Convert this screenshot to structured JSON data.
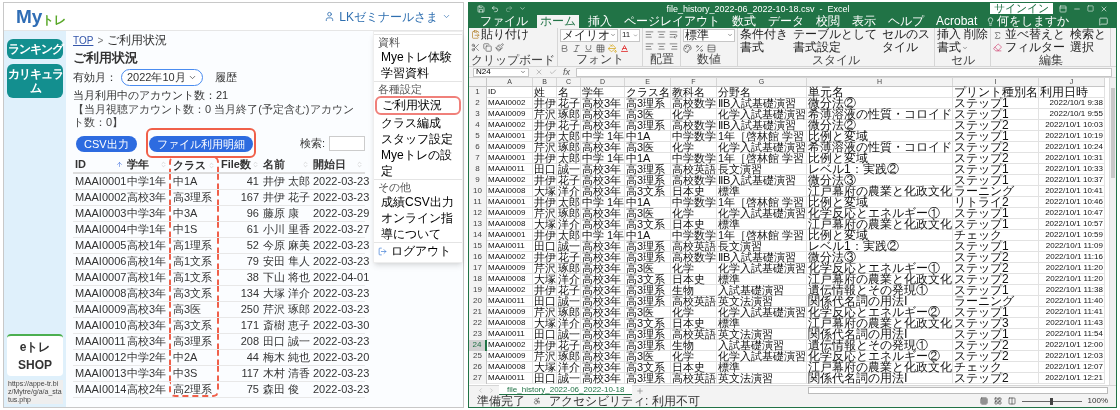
{
  "web_page": {
    "logo": {
      "main": "My",
      "sub": "トレ"
    },
    "user_menu": "LKゼミナールさま",
    "sidebar": {
      "buttons": [
        "ランキング",
        "カリキュラム"
      ],
      "shop_logo": "eトレSHOP"
    },
    "status_url": "https://appe-tr.biz/Mytre/g/a/a_status.php",
    "breadcrumb": {
      "link": "TOP",
      "separator": ">",
      "current": "ご利用状況"
    },
    "title": "ご利用状況",
    "month_filter": {
      "label": "有効月：",
      "value": "2022年10月",
      "history_link": "履歴"
    },
    "account_count": "当月利用中のアカウント数：21",
    "account_note": "【当月視聴アカウント数：0 当月終了(予定含む)アカウント数：0】",
    "buttons": [
      {
        "label": "CSV出力",
        "highlighted": false
      },
      {
        "label": "ファイル利用明細",
        "highlighted": true
      }
    ],
    "search_label": "検索:",
    "table": {
      "columns": [
        {
          "label": "ID",
          "sorted": true,
          "highlighted": false
        },
        {
          "label": "学年",
          "sorted": false,
          "highlighted": false
        },
        {
          "label": "クラス",
          "sorted": false,
          "highlighted": true
        },
        {
          "label": "File数",
          "sorted": false,
          "highlighted": false
        },
        {
          "label": "名前",
          "sorted": false,
          "highlighted": false
        },
        {
          "label": "開始日",
          "sorted": false,
          "highlighted": false
        }
      ],
      "rows": [
        [
          "MAAI0001",
          "中学1年",
          "中1A",
          "41",
          "井伊 太郎",
          "2022-03-23"
        ],
        [
          "MAAI0002",
          "高校3年",
          "高3理系",
          "167",
          "井伊 花子",
          "2022-03-23"
        ],
        [
          "MAAI0003",
          "中学3年",
          "中3A",
          "96",
          "藤原 康",
          "2022-03-29"
        ],
        [
          "MAAI0004",
          "中学1年",
          "中1S",
          "61",
          "小川 里香",
          "2022-03-27"
        ],
        [
          "MAAI0005",
          "高校1年",
          "高1理系",
          "52",
          "今原 麻美",
          "2022-03-23"
        ],
        [
          "MAAI0006",
          "高校1年",
          "高1文系",
          "79",
          "安田 隼人",
          "2022-03-23"
        ],
        [
          "MAAI0007",
          "高校1年",
          "高1文系",
          "38",
          "下山 将也",
          "2022-04-01"
        ],
        [
          "MAAI0008",
          "高校3年",
          "高3文系",
          "134",
          "大塚 洋介",
          "2022-03-23"
        ],
        [
          "MAAI0009",
          "高校3年",
          "高3医",
          "250",
          "芹沢 琢郎",
          "2022-03-23"
        ],
        [
          "MAAI0010",
          "高校3年",
          "高3文系",
          "171",
          "斎樹 恵子",
          "2022-03-30"
        ],
        [
          "MAAI0011",
          "高校3年",
          "高3理系",
          "208",
          "田口 誠一",
          "2022-03-23"
        ],
        [
          "MAAI0012",
          "中学2年",
          "中2A",
          "44",
          "梅木 純也",
          "2022-03-20"
        ],
        [
          "MAAI0013",
          "中学3年",
          "中3S",
          "117",
          "木村 清香",
          "2022-03-23"
        ],
        [
          "MAAI0014",
          "高校2年",
          "高2理系",
          "75",
          "森田 俊",
          "2022-03-23"
        ]
      ]
    },
    "dropdown_menu": [
      {
        "kind": "heading",
        "label": "資料"
      },
      {
        "kind": "item",
        "label": "Myeトレ体験",
        "highlighted": false
      },
      {
        "kind": "item",
        "label": "学習資料",
        "highlighted": false
      },
      {
        "kind": "heading",
        "label": "各種設定"
      },
      {
        "kind": "item",
        "label": "ご利用状況",
        "highlighted": true
      },
      {
        "kind": "item",
        "label": "クラス編成",
        "highlighted": false
      },
      {
        "kind": "item",
        "label": "スタッフ設定",
        "highlighted": false
      },
      {
        "kind": "item",
        "label": "Myeトレの設定",
        "highlighted": false
      },
      {
        "kind": "heading",
        "label": "その他"
      },
      {
        "kind": "item",
        "label": "成績CSV出力",
        "highlighted": false
      },
      {
        "kind": "item",
        "label": "オンライン指導について",
        "highlighted": false
      },
      {
        "kind": "logout",
        "label": "ログアウト"
      }
    ]
  },
  "excel": {
    "title": "file_history_2022-06_2022-10-18.csv  -  Excel",
    "sign_in": "サインイン",
    "tabs": [
      {
        "label": "ファイル",
        "selected": false
      },
      {
        "label": "ホーム",
        "selected": true
      },
      {
        "label": "挿入",
        "selected": false
      },
      {
        "label": "ページレイアウト",
        "selected": false
      },
      {
        "label": "数式",
        "selected": false
      },
      {
        "label": "データ",
        "selected": false
      },
      {
        "label": "校閲",
        "selected": false
      },
      {
        "label": "表示",
        "selected": false
      },
      {
        "label": "ヘルプ",
        "selected": false
      },
      {
        "label": "Acrobat",
        "selected": false
      }
    ],
    "tell_me": "何をしますか",
    "ribbon": {
      "font_name": "メイリオ",
      "font_size": "11",
      "number_format": "標準",
      "groups": [
        {
          "kind": "clipboard",
          "label": "クリップボード",
          "buttons": [
            "貼り付け"
          ]
        },
        {
          "kind": "font",
          "label": "フォント"
        },
        {
          "kind": "alignment",
          "label": "配置"
        },
        {
          "kind": "number",
          "label": "数値"
        },
        {
          "kind": "styles",
          "label": "スタイル",
          "buttons": [
            "条件付き書式",
            "テーブルとして書式設定",
            "セルのスタイル"
          ]
        },
        {
          "kind": "cells",
          "label": "セル",
          "buttons": [
            "挿入",
            "削除",
            "書式"
          ]
        },
        {
          "kind": "editing",
          "label": "編集",
          "buttons": [
            "並べ替えとフィルター",
            "検索と選択"
          ]
        }
      ]
    },
    "name_box": "N24",
    "function_label": "fx",
    "column_letters": [
      "A",
      "B",
      "C",
      "D",
      "E",
      "F",
      "G",
      "H",
      "I",
      "J"
    ],
    "rows": [
      {
        "number": "1",
        "selected": false,
        "cells": [
          "ID",
          "姓",
          "名",
          "学年",
          "クラス名",
          "教科名",
          "分野名",
          "単元名",
          "プリント種別名",
          "利用日時"
        ]
      },
      {
        "number": "2",
        "selected": false,
        "cells": [
          "MAAI0002",
          "井伊",
          "花子",
          "高校3年",
          "高3理系",
          "高校数学",
          "ⅡB入試基礎演習",
          "微分法②",
          "ステップ1",
          "2022/10/1 9:38"
        ]
      },
      {
        "number": "3",
        "selected": false,
        "cells": [
          "MAAI0009",
          "芹沢",
          "琢郎",
          "高校3年",
          "高3医",
          "化学",
          "化学入試基礎演習",
          "希薄溶液の性質・コロイド",
          "ステップ1",
          "2022/10/1 9:55"
        ]
      },
      {
        "number": "4",
        "selected": false,
        "cells": [
          "MAAI0002",
          "井伊",
          "花子",
          "高校3年",
          "高3理系",
          "高校数学",
          "ⅡB入試基礎演習",
          "微分法②",
          "ステップ2",
          "2022/10/1 10:03"
        ]
      },
      {
        "number": "5",
        "selected": false,
        "cells": [
          "MAAI0001",
          "井伊",
          "太郎",
          "中学 1年",
          "中1A",
          "中学数学",
          "1年［啓林館 学習",
          "比例と変域",
          "ステップ1",
          "2022/10/1 10:19"
        ]
      },
      {
        "number": "6",
        "selected": false,
        "cells": [
          "MAAI0009",
          "芹沢",
          "琢郎",
          "高校3年",
          "高3医",
          "化学",
          "化学入試基礎演習",
          "希薄溶液の性質・コロイド",
          "ステップ2",
          "2022/10/1 10:24"
        ]
      },
      {
        "number": "7",
        "selected": false,
        "cells": [
          "MAAI0001",
          "井伊",
          "太郎",
          "中学 1年",
          "中1A",
          "中学数学",
          "1年［啓林館 学習",
          "比例と変域",
          "ステップ2",
          "2022/10/1 10:31"
        ]
      },
      {
        "number": "8",
        "selected": false,
        "cells": [
          "MAAI0011",
          "田口",
          "誠一",
          "高校3年",
          "高3理系",
          "高校英語",
          "長文演習",
          "レベル1：実践②",
          "ステップ1",
          "2022/10/1 10:33"
        ]
      },
      {
        "number": "9",
        "selected": false,
        "cells": [
          "MAAI0002",
          "井伊",
          "花子",
          "高校3年",
          "高3理系",
          "高校数学",
          "ⅡB入試基礎演習",
          "微分法③",
          "ステップ1",
          "2022/10/1 10:37"
        ]
      },
      {
        "number": "10",
        "selected": false,
        "cells": [
          "MAAI0008",
          "大塚",
          "洋介",
          "高校3年",
          "高3文系",
          "日本史",
          "標準",
          "江戸幕府の農業と化政文化",
          "ラーニング",
          "2022/10/1 10:41"
        ]
      },
      {
        "number": "11",
        "selected": false,
        "cells": [
          "MAAI0001",
          "井伊",
          "太郎",
          "中学 1年",
          "中1A",
          "中学数学",
          "1年［啓林館 学習",
          "比例と変域",
          "リトライ2",
          "2022/10/1 10:46"
        ]
      },
      {
        "number": "12",
        "selected": false,
        "cells": [
          "MAAI0009",
          "芹沢",
          "琢郎",
          "高校3年",
          "高3医",
          "化学",
          "化学入試基礎演習",
          "化学反応とエネルギー①",
          "ステップ1",
          "2022/10/1 10:47"
        ]
      },
      {
        "number": "13",
        "selected": false,
        "cells": [
          "MAAI0008",
          "大塚",
          "洋介",
          "高校3年",
          "高3文系",
          "日本史",
          "標準",
          "江戸幕府の農業と化政文化",
          "ステップ1",
          "2022/10/1 10:57"
        ]
      },
      {
        "number": "14",
        "selected": false,
        "cells": [
          "MAAI0001",
          "井伊",
          "太郎",
          "中学 1年",
          "中1A",
          "中学数学",
          "1年［啓林館 学習",
          "比例と変域",
          "チェック",
          "2022/10/1 10:59"
        ]
      },
      {
        "number": "15",
        "selected": false,
        "cells": [
          "MAAI0011",
          "田口",
          "誠一",
          "高校3年",
          "高3理系",
          "高校英語",
          "長文演習",
          "レベル1：実践②",
          "ステップ1",
          "2022/10/1 11:09"
        ]
      },
      {
        "number": "16",
        "selected": false,
        "cells": [
          "MAAI0002",
          "井伊",
          "花子",
          "高校3年",
          "高3理系",
          "高校数学",
          "ⅡB入試基礎演習",
          "微分法③",
          "ステップ2",
          "2022/10/1 11:16"
        ]
      },
      {
        "number": "17",
        "selected": false,
        "cells": [
          "MAAI0009",
          "芹沢",
          "琢郎",
          "高校3年",
          "高3医",
          "化学",
          "化学入試基礎演習",
          "化学反応とエネルギー①",
          "ステップ2",
          "2022/10/1 11:20"
        ]
      },
      {
        "number": "18",
        "selected": false,
        "cells": [
          "MAAI0008",
          "大塚",
          "洋介",
          "高校3年",
          "高3文系",
          "日本史",
          "標準",
          "江戸幕府の農業と化政文化",
          "ステップ2",
          "2022/10/1 11:20"
        ]
      },
      {
        "number": "19",
        "selected": false,
        "cells": [
          "MAAI0002",
          "井伊",
          "花子",
          "高校3年",
          "高3理系",
          "生物",
          "入試基礎演習",
          "遺伝情報とその発現①",
          "ステップ1",
          "2022/10/1 11:38"
        ]
      },
      {
        "number": "20",
        "selected": false,
        "cells": [
          "MAAI0011",
          "田口",
          "誠一",
          "高校3年",
          "高3理系",
          "高校英語",
          "英文法演習",
          "関係代名詞の用法Ⅰ",
          "ラーニング",
          "2022/10/1 11:40"
        ]
      },
      {
        "number": "21",
        "selected": false,
        "cells": [
          "MAAI0009",
          "芹沢",
          "琢郎",
          "高校3年",
          "高3医",
          "化学",
          "化学入試基礎演習",
          "化学反応とエネルギー②",
          "ステップ1",
          "2022/10/1 11:41"
        ]
      },
      {
        "number": "22",
        "selected": false,
        "cells": [
          "MAAI0008",
          "大塚",
          "洋介",
          "高校3年",
          "高3文系",
          "日本史",
          "標準",
          "江戸幕府の農業と化政文化",
          "ステップ3",
          "2022/10/1 11:43"
        ]
      },
      {
        "number": "23",
        "selected": false,
        "cells": [
          "MAAI0011",
          "田口",
          "誠一",
          "高校3年",
          "高3理系",
          "高校英語",
          "英文法演習",
          "関係代名詞の用法Ⅰ",
          "ステップ1",
          "2022/10/1 11:54"
        ]
      },
      {
        "number": "24",
        "selected": true,
        "cells": [
          "MAAI0002",
          "井伊",
          "花子",
          "高校3年",
          "高3理系",
          "生物",
          "入試基礎演習",
          "遺伝情報とその発現①",
          "ステップ2",
          "2022/10/1 12:00"
        ]
      },
      {
        "number": "25",
        "selected": false,
        "cells": [
          "MAAI0009",
          "芹沢",
          "琢郎",
          "高校3年",
          "高3医",
          "化学",
          "化学入試基礎演習",
          "化学反応とエネルギー②",
          "ステップ2",
          "2022/10/1 12:03"
        ]
      },
      {
        "number": "26",
        "selected": false,
        "cells": [
          "MAAI0008",
          "大塚",
          "洋介",
          "高校3年",
          "高3文系",
          "日本史",
          "標準",
          "江戸幕府の農業と化政文化",
          "チェック",
          "2022/10/1 12:07"
        ]
      },
      {
        "number": "27",
        "selected": false,
        "cells": [
          "MAAI0011",
          "田口",
          "誠一",
          "高校3年",
          "高3理系",
          "高校英語",
          "英文法演習",
          "関係代名詞の用法Ⅰ",
          "ステップ2",
          "2022/10/1 12:21"
        ]
      }
    ],
    "sheet_tab": {
      "label": "file_history_2022-06_2022-10-18",
      "selected": true
    },
    "status": {
      "ready": "準備完了",
      "accessibility": "アクセシビリティ: 利用不可",
      "zoom": {
        "level": 0.5,
        "reading": "100%"
      }
    }
  }
}
